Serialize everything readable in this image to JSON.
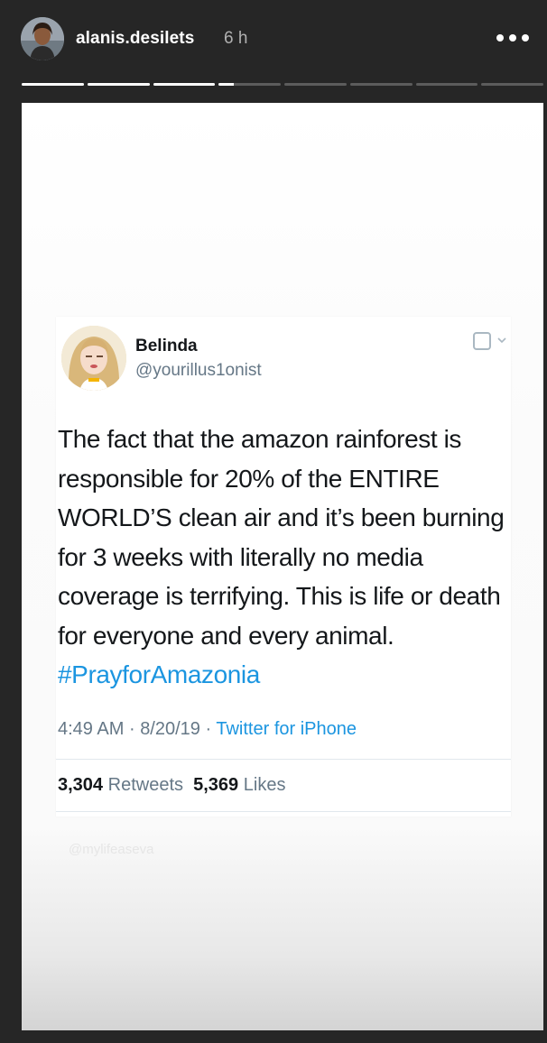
{
  "header": {
    "username": "alanis.desilets",
    "timestamp": "6 h",
    "more_icon": "more-horizontal-icon"
  },
  "progress": {
    "segments": [
      1,
      1,
      1,
      0.25,
      0,
      0,
      0,
      0
    ]
  },
  "tweet": {
    "name": "Belinda",
    "handle": "@yourillus1onist",
    "text": "The fact that the amazon rainforest is responsible for 20% of the ENTIRE WORLD’S clean air and it’s been burning for 3 weeks with literally no media coverage is terrifying. This is life or death for everyone and every animal.",
    "hashtag": "#PrayforAmazonia",
    "time": "4:49 AM",
    "date": "8/20/19",
    "separator": "·",
    "source": "Twitter for iPhone",
    "retweets_count": "3,304",
    "retweets_label": "Retweets",
    "likes_count": "5,369",
    "likes_label": "Likes",
    "check_icon": "checkbox-icon",
    "chevron_icon": "chevron-down-icon",
    "accent_color": "#1b95e0"
  },
  "watermark": "@mylifeaseva"
}
